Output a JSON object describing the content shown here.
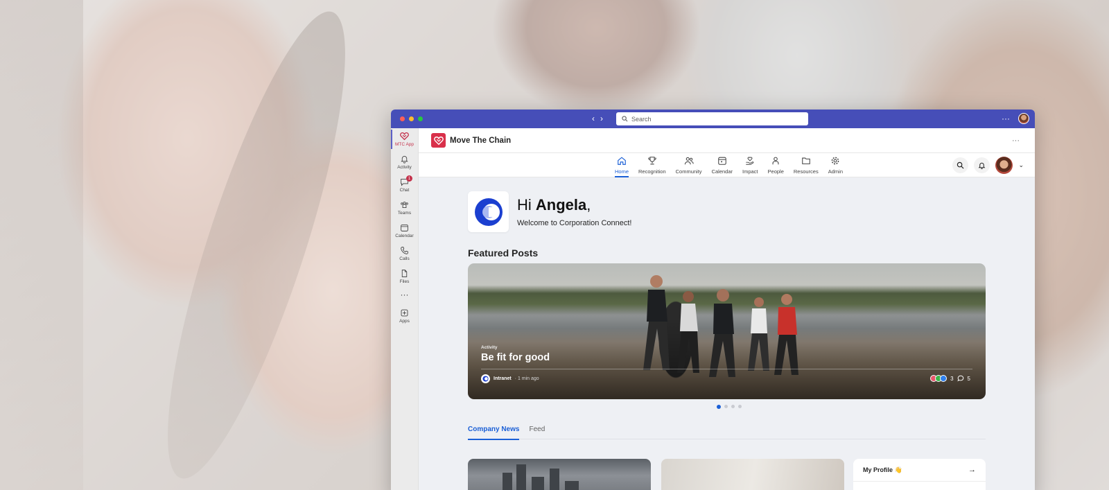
{
  "window": {
    "search_placeholder": "Search",
    "more": "···"
  },
  "rail": {
    "items": [
      {
        "label": "MTC App",
        "icon": "heart-logo-icon",
        "active": true
      },
      {
        "label": "Activity",
        "icon": "bell-icon"
      },
      {
        "label": "Chat",
        "icon": "chat-icon",
        "badge": "1"
      },
      {
        "label": "Teams",
        "icon": "teams-icon"
      },
      {
        "label": "Calendar",
        "icon": "calendar-icon"
      },
      {
        "label": "Calls",
        "icon": "phone-icon"
      },
      {
        "label": "Files",
        "icon": "file-icon"
      },
      {
        "label": "Apps",
        "icon": "add-apps-icon"
      }
    ],
    "more": "···"
  },
  "app": {
    "title": "Move The Chain",
    "more": "···"
  },
  "nav": {
    "items": [
      {
        "label": "Home",
        "icon": "home-icon",
        "active": true
      },
      {
        "label": "Recognition",
        "icon": "trophy-icon"
      },
      {
        "label": "Community",
        "icon": "people-community-icon"
      },
      {
        "label": "Calendar",
        "icon": "calendar-icon"
      },
      {
        "label": "Impact",
        "icon": "hand-heart-icon"
      },
      {
        "label": "People",
        "icon": "person-icon"
      },
      {
        "label": "Resources",
        "icon": "folder-icon"
      },
      {
        "label": "Admin",
        "icon": "gear-icon"
      }
    ]
  },
  "greeting": {
    "hi": "Hi",
    "name": "Angela",
    "comma": ",",
    "welcome": "Welcome to Corporation Connect!"
  },
  "featured": {
    "title": "Featured Posts",
    "post": {
      "category": "Activity",
      "title": "Be fit for good",
      "source": "Intranet",
      "time": "· 1 min ago",
      "reactions": "3",
      "comments": "5"
    },
    "pages": 4,
    "current_page": 1
  },
  "tabs": [
    {
      "label": "Company News",
      "active": true
    },
    {
      "label": "Feed"
    }
  ],
  "profile_card": {
    "title": "My Profile 👋"
  },
  "colors": {
    "titlebar": "#464eb8",
    "accent": "#1a5fd6",
    "brand": "#d9304a"
  }
}
